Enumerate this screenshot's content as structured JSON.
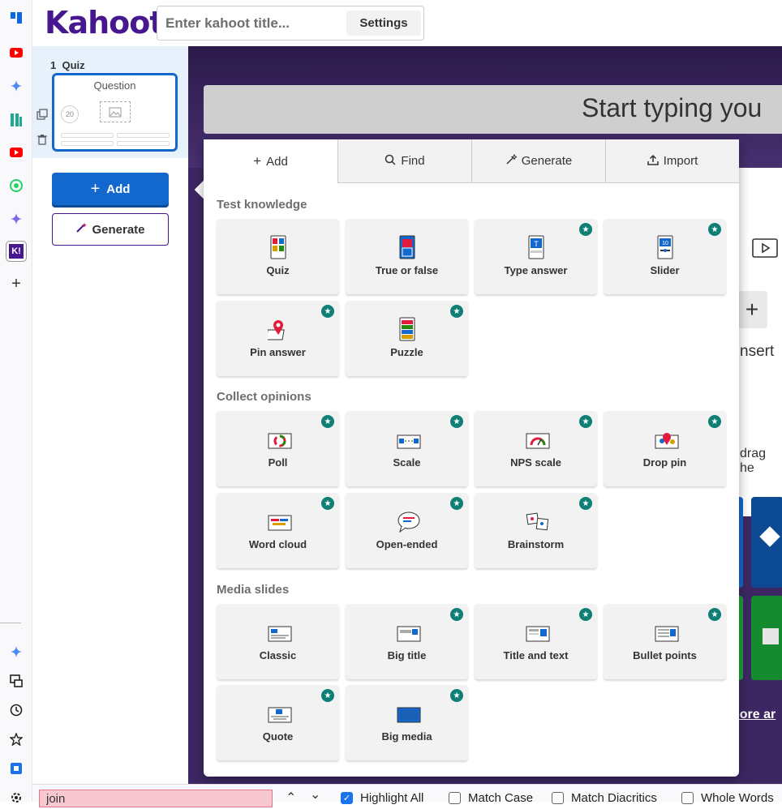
{
  "app": {
    "logo": "Kahoot!"
  },
  "header": {
    "title_placeholder": "Enter kahoot title...",
    "settings_label": "Settings"
  },
  "browser_sidebar": {
    "icons": [
      "trello-icon",
      "youtube-icon",
      "gemini-icon",
      "app-icon",
      "youtube-icon",
      "whatsapp-icon",
      "gemini-icon",
      "kahoot-icon",
      "plus-icon"
    ],
    "bottom_icons": [
      "gemini-icon",
      "device-icon",
      "history-icon",
      "bookmark-star-icon",
      "extension-icon",
      "settings-icon"
    ]
  },
  "slides": [
    {
      "number": "1",
      "type": "Quiz",
      "title": "Question",
      "timer": "20"
    }
  ],
  "sidebar_buttons": {
    "add": "Add",
    "generate": "Generate"
  },
  "canvas": {
    "question_placeholder": "Start typing you",
    "insert_text": "nsert",
    "drag_text": "drag he",
    "learn_more": "nore ar"
  },
  "popup": {
    "tabs": [
      {
        "label": "Add",
        "icon": "plus-icon",
        "active": true
      },
      {
        "label": "Find",
        "icon": "search-icon",
        "active": false
      },
      {
        "label": "Generate",
        "icon": "magic-wand-icon",
        "active": false
      },
      {
        "label": "Import",
        "icon": "upload-icon",
        "active": false
      }
    ],
    "sections": [
      {
        "title": "Test knowledge",
        "items": [
          {
            "label": "Quiz",
            "premium": false
          },
          {
            "label": "True or false",
            "premium": false
          },
          {
            "label": "Type answer",
            "premium": true
          },
          {
            "label": "Slider",
            "premium": true
          },
          {
            "label": "Pin answer",
            "premium": true
          },
          {
            "label": "Puzzle",
            "premium": true
          }
        ]
      },
      {
        "title": "Collect opinions",
        "items": [
          {
            "label": "Poll",
            "premium": true
          },
          {
            "label": "Scale",
            "premium": true
          },
          {
            "label": "NPS scale",
            "premium": true
          },
          {
            "label": "Drop pin",
            "premium": true
          },
          {
            "label": "Word cloud",
            "premium": true
          },
          {
            "label": "Open-ended",
            "premium": true
          },
          {
            "label": "Brainstorm",
            "premium": true
          }
        ]
      },
      {
        "title": "Media slides",
        "items": [
          {
            "label": "Classic",
            "premium": false
          },
          {
            "label": "Big title",
            "premium": true
          },
          {
            "label": "Title and text",
            "premium": true
          },
          {
            "label": "Bullet points",
            "premium": true
          },
          {
            "label": "Quote",
            "premium": true
          },
          {
            "label": "Big media",
            "premium": true
          }
        ]
      }
    ]
  },
  "findbar": {
    "query": "join",
    "options": [
      {
        "label": "Highlight All",
        "checked": true
      },
      {
        "label": "Match Case",
        "checked": false
      },
      {
        "label": "Match Diacritics",
        "checked": false
      },
      {
        "label": "Whole Words",
        "checked": false
      }
    ]
  },
  "colors": {
    "brand": "#46178f",
    "primary": "#1368ce",
    "premium_star": "#0f7f75"
  }
}
